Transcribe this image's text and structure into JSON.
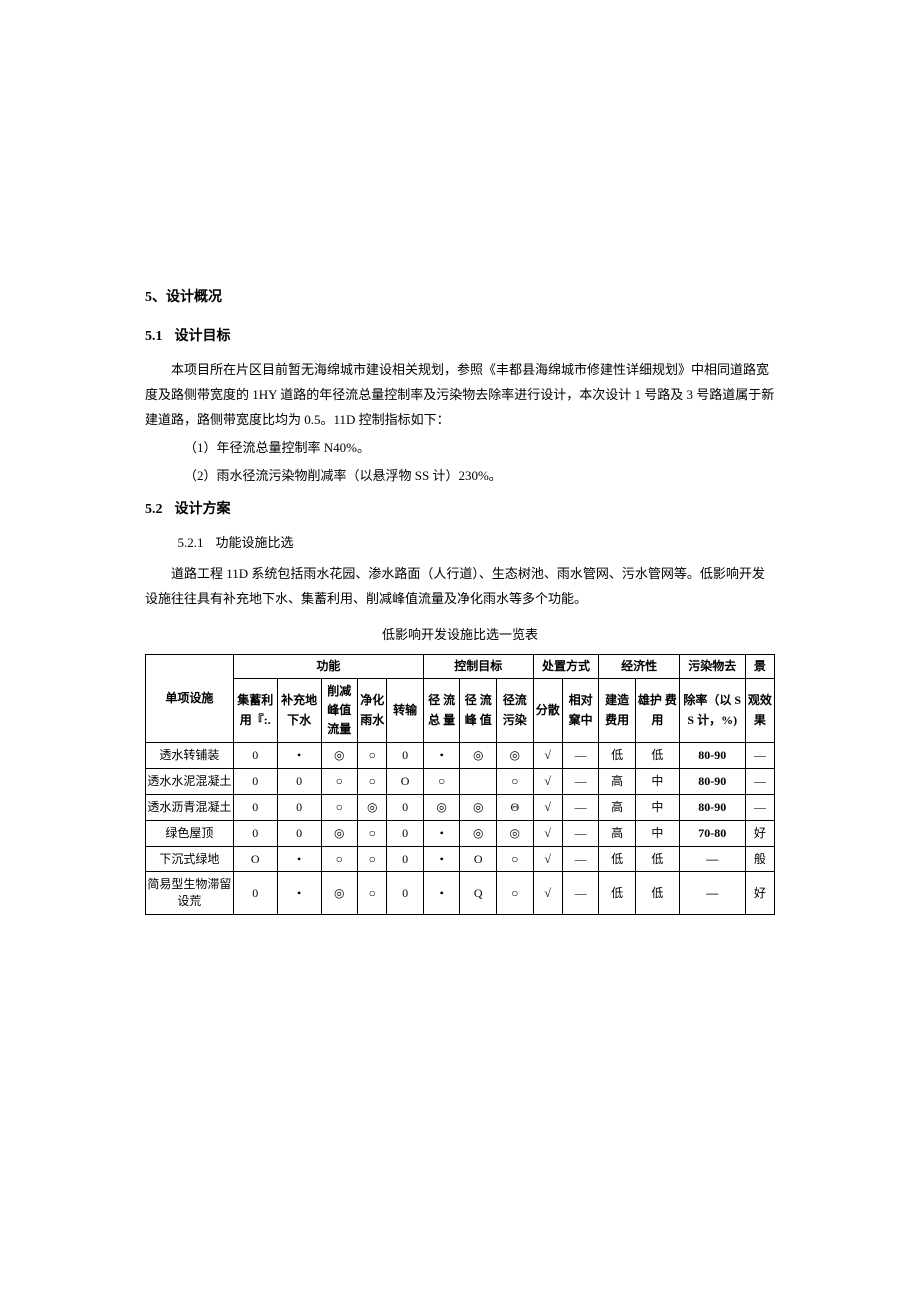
{
  "h5": "5、设计概况",
  "h51": {
    "num": "5.1",
    "title": "设计目标"
  },
  "p51a": "本项目所在片区目前暂无海绵城市建设相关规划，参照《丰都县海绵城市修建性详细规划》中相同道路宽度及路侧带宽度的 1HY 道路的年径流总量控制率及污染物去除率进行设计，本次设计 1 号路及 3 号路道属于新建道路，路侧带宽度比均为 0.5。11D 控制指标如下：",
  "p51b": "（1）年径流总量控制率 N40%。",
  "p51c": "（2）雨水径流污染物削减率（以悬浮物 SS 计）230%。",
  "h52": {
    "num": "5.2",
    "title": "设计方案"
  },
  "h521": {
    "num": "5.2.1",
    "title": "功能设施比选"
  },
  "p521a": "道路工程 11D 系统包括雨水花园、渗水路面（人行道）、生态树池、雨水管网、污水管网等。低影响开发设施往往具有补充地下水、集蓄利用、削减峰值流量及净化雨水等多个功能。",
  "tableTitle": "低影响开发设施比选一览表",
  "headers": {
    "facility": "单项设施",
    "function": "功能",
    "control": "控制目标",
    "dispose": "处置方式",
    "economy": "经济性",
    "pollutant": "污染物去",
    "landscape": "景",
    "col_jixu": "集蓄利用『:.",
    "col_buchong": "补充地下水",
    "col_xuejian": "削减峰值流量",
    "col_jinghua": "净化雨水",
    "col_zhuanshu": "转输",
    "col_jlzl": "径 流 总 量",
    "col_jlfz": "径 流 峰 值",
    "col_jlwr": "径流污染",
    "col_fensan": "分散",
    "col_xiangdui": "相对窠中",
    "col_jianzao": "建造费用",
    "col_weihu": "雄护 费用",
    "col_churate": "除率（以 SS 计，%)",
    "col_jingguan": "观效果"
  },
  "rows": [
    {
      "name": "透水转铺装",
      "c1": "0",
      "c2": "•",
      "c3": "◎",
      "c4": "○",
      "c5": "0",
      "c6": "•",
      "c7": "◎",
      "c8": "◎",
      "c9": "√",
      "c10": "—",
      "c11": "低",
      "c12": "低",
      "c13": "80-90",
      "c14": "—"
    },
    {
      "name": "透水水泥混凝土",
      "c1": "0",
      "c2": "0",
      "c3": "○",
      "c4": "○",
      "c5": "O",
      "c6": "○",
      "c7": "",
      "c8": "○",
      "c9": "√",
      "c10": "—",
      "c11": "高",
      "c12": "中",
      "c13": "80-90",
      "c14": "—"
    },
    {
      "name": "透水沥青混凝土",
      "c1": "0",
      "c2": "0",
      "c3": "○",
      "c4": "◎",
      "c5": "0",
      "c6": "◎",
      "c7": "◎",
      "c8": "Θ",
      "c9": "√",
      "c10": "—",
      "c11": "高",
      "c12": "中",
      "c13": "80-90",
      "c14": "—"
    },
    {
      "name": "绿色屋顶",
      "c1": "0",
      "c2": "0",
      "c3": "◎",
      "c4": "○",
      "c5": "0",
      "c6": "•",
      "c7": "◎",
      "c8": "◎",
      "c9": "√",
      "c10": "—",
      "c11": "高",
      "c12": "中",
      "c13": "70-80",
      "c14": "好"
    },
    {
      "name": "下沉式绿地",
      "c1": "O",
      "c2": "•",
      "c3": "○",
      "c4": "○",
      "c5": "0",
      "c6": "•",
      "c7": "O",
      "c8": "○",
      "c9": "√",
      "c10": "—",
      "c11": "低",
      "c12": "低",
      "c13": "—",
      "c14": "般"
    },
    {
      "name": "简易型生物滞留设荒",
      "c1": "0",
      "c2": "•",
      "c3": "◎",
      "c4": "○",
      "c5": "0",
      "c6": "•",
      "c7": "Q",
      "c8": "○",
      "c9": "√",
      "c10": "—",
      "c11": "低",
      "c12": "低",
      "c13": "—",
      "c14": "好"
    }
  ]
}
